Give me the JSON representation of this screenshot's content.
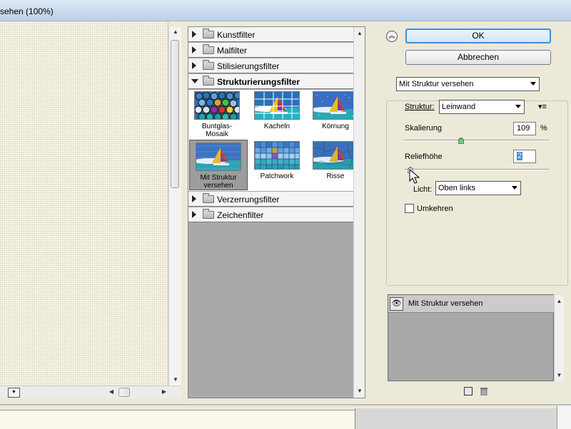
{
  "window": {
    "title": "sehen (100%)"
  },
  "gallery": {
    "categories_top": [
      "Kunstfilter",
      "Malfilter",
      "Stilisierungsfilter"
    ],
    "open_category": "Strukturierungsfilter",
    "thumbnails": [
      {
        "label": "Buntglas-Mosaik",
        "icon": "stained-glass-thumb"
      },
      {
        "label": "Kacheln",
        "icon": "tiles-thumb"
      },
      {
        "label": "Körnung",
        "icon": "grain-thumb"
      },
      {
        "label": "Mit Struktur versehen",
        "icon": "texturizer-thumb",
        "selected": true
      },
      {
        "label": "Patchwork",
        "icon": "patchwork-thumb"
      },
      {
        "label": "Risse",
        "icon": "craquelure-thumb"
      }
    ],
    "categories_bottom": [
      "Verzerrungsfilter",
      "Zeichenfilter"
    ]
  },
  "settings": {
    "ok_label": "OK",
    "cancel_label": "Abbrechen",
    "filter_select": "Mit Struktur versehen",
    "struktur_label": "Struktur:",
    "struktur_value": "Leinwand",
    "skalierung_label": "Skalierung",
    "skalierung_value": "109",
    "skalierung_unit": "%",
    "skalierung_level": 109,
    "reliefhoehe_label": "Reliefhöhe",
    "reliefhoehe_value": "2",
    "reliefhoehe_level": 2,
    "licht_label": "Licht:",
    "licht_value": "Oben links",
    "umkehren_label": "Umkehren",
    "umkehren_checked": false
  },
  "layers": {
    "items": [
      {
        "label": "Mit Struktur versehen",
        "visible": true
      }
    ]
  },
  "colors": {
    "accent": "#3a8fd9",
    "panel_bg": "#ece9d8",
    "gallery_bg": "#a9a9a9"
  }
}
